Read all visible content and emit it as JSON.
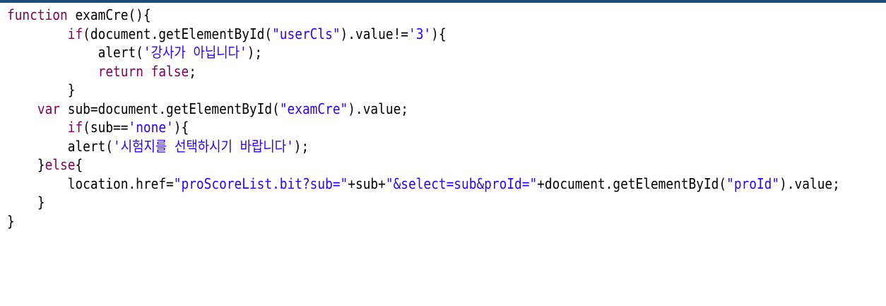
{
  "colors": {
    "keyword": "#7f0055",
    "string": "#2a00ff",
    "plain": "#000000",
    "top_border": "#1f4e79"
  },
  "code_lines": [
    {
      "indent": "",
      "tokens": [
        {
          "t": "kw",
          "v": "function"
        },
        {
          "t": "plain",
          "v": " examCre(){"
        }
      ]
    },
    {
      "indent": "        ",
      "tokens": [
        {
          "t": "kw",
          "v": "if"
        },
        {
          "t": "plain",
          "v": "(document.getElementById("
        },
        {
          "t": "str",
          "v": "\"userCls\""
        },
        {
          "t": "plain",
          "v": ").value!="
        },
        {
          "t": "str",
          "v": "'3'"
        },
        {
          "t": "plain",
          "v": "){"
        }
      ]
    },
    {
      "indent": "            ",
      "tokens": [
        {
          "t": "plain",
          "v": "alert("
        },
        {
          "t": "str",
          "v": "'강사가 아닙니다'"
        },
        {
          "t": "plain",
          "v": ");"
        }
      ]
    },
    {
      "indent": "            ",
      "tokens": [
        {
          "t": "kw",
          "v": "return"
        },
        {
          "t": "plain",
          "v": " "
        },
        {
          "t": "kw",
          "v": "false"
        },
        {
          "t": "plain",
          "v": ";"
        }
      ]
    },
    {
      "indent": "        ",
      "tokens": [
        {
          "t": "plain",
          "v": "}"
        }
      ]
    },
    {
      "indent": "    ",
      "tokens": [
        {
          "t": "kw",
          "v": "var"
        },
        {
          "t": "plain",
          "v": " sub=document.getElementById("
        },
        {
          "t": "str",
          "v": "\"examCre\""
        },
        {
          "t": "plain",
          "v": ").value;"
        }
      ]
    },
    {
      "indent": "        ",
      "tokens": [
        {
          "t": "kw",
          "v": "if"
        },
        {
          "t": "plain",
          "v": "(sub=="
        },
        {
          "t": "str",
          "v": "'none'"
        },
        {
          "t": "plain",
          "v": "){"
        }
      ]
    },
    {
      "indent": "        ",
      "tokens": [
        {
          "t": "plain",
          "v": "alert("
        },
        {
          "t": "str",
          "v": "'시험지를 선택하시기 바랍니다'"
        },
        {
          "t": "plain",
          "v": ");"
        }
      ]
    },
    {
      "indent": "    ",
      "tokens": [
        {
          "t": "plain",
          "v": "}"
        },
        {
          "t": "kw",
          "v": "else"
        },
        {
          "t": "plain",
          "v": "{"
        }
      ]
    },
    {
      "indent": "        ",
      "tokens": [
        {
          "t": "plain",
          "v": "location.href="
        },
        {
          "t": "str",
          "v": "\"proScoreList.bit?sub=\""
        },
        {
          "t": "plain",
          "v": "+sub+"
        },
        {
          "t": "str",
          "v": "\"&select=sub&proId=\""
        },
        {
          "t": "plain",
          "v": "+document.getElementById("
        },
        {
          "t": "str",
          "v": "\"proId\""
        },
        {
          "t": "plain",
          "v": ").value;"
        }
      ]
    },
    {
      "indent": "    ",
      "tokens": [
        {
          "t": "plain",
          "v": "}"
        }
      ]
    },
    {
      "indent": "",
      "tokens": [
        {
          "t": "plain",
          "v": "}"
        }
      ]
    }
  ]
}
